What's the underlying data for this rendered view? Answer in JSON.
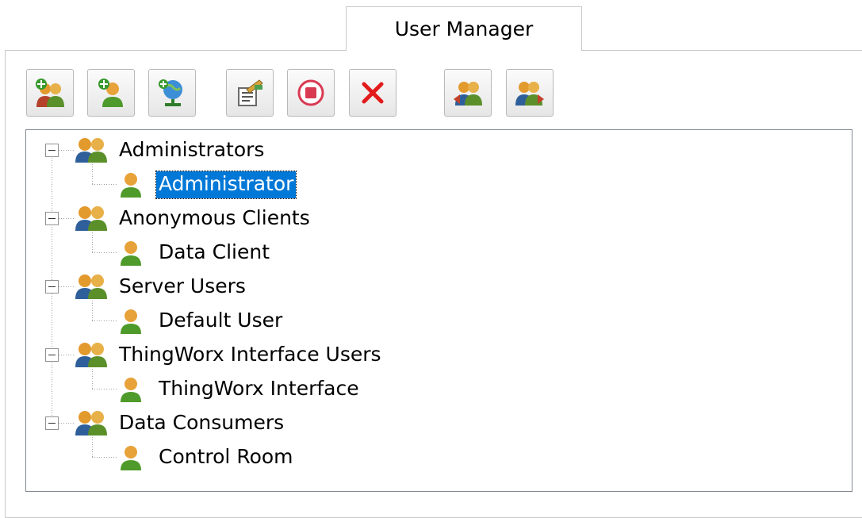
{
  "tab": {
    "label": "User Manager"
  },
  "toolbar": {
    "buttons": [
      {
        "name": "add-user-group-button",
        "icon": "add-group-icon"
      },
      {
        "name": "add-user-button",
        "icon": "add-user-icon"
      },
      {
        "name": "import-users-button",
        "icon": "globe-user-icon"
      },
      {
        "name": "properties-button",
        "icon": "properties-icon"
      },
      {
        "name": "disable-button",
        "icon": "stop-icon"
      },
      {
        "name": "delete-button",
        "icon": "delete-x-icon"
      },
      {
        "name": "move-users-left-button",
        "icon": "move-left-icon"
      },
      {
        "name": "move-users-right-button",
        "icon": "move-right-icon"
      }
    ]
  },
  "tree": {
    "groups": [
      {
        "label": "Administrators",
        "users": [
          {
            "label": "Administrator",
            "selected": true
          }
        ]
      },
      {
        "label": "Anonymous Clients",
        "users": [
          {
            "label": "Data Client"
          }
        ]
      },
      {
        "label": "Server Users",
        "users": [
          {
            "label": "Default User"
          }
        ]
      },
      {
        "label": "ThingWorx Interface Users",
        "users": [
          {
            "label": "ThingWorx Interface"
          }
        ]
      },
      {
        "label": "Data Consumers",
        "users": [
          {
            "label": "Control Room"
          }
        ]
      }
    ]
  },
  "colors": {
    "selection": "#0078d7",
    "tree_border": "#828790",
    "tab_border": "#c8c8c8"
  }
}
